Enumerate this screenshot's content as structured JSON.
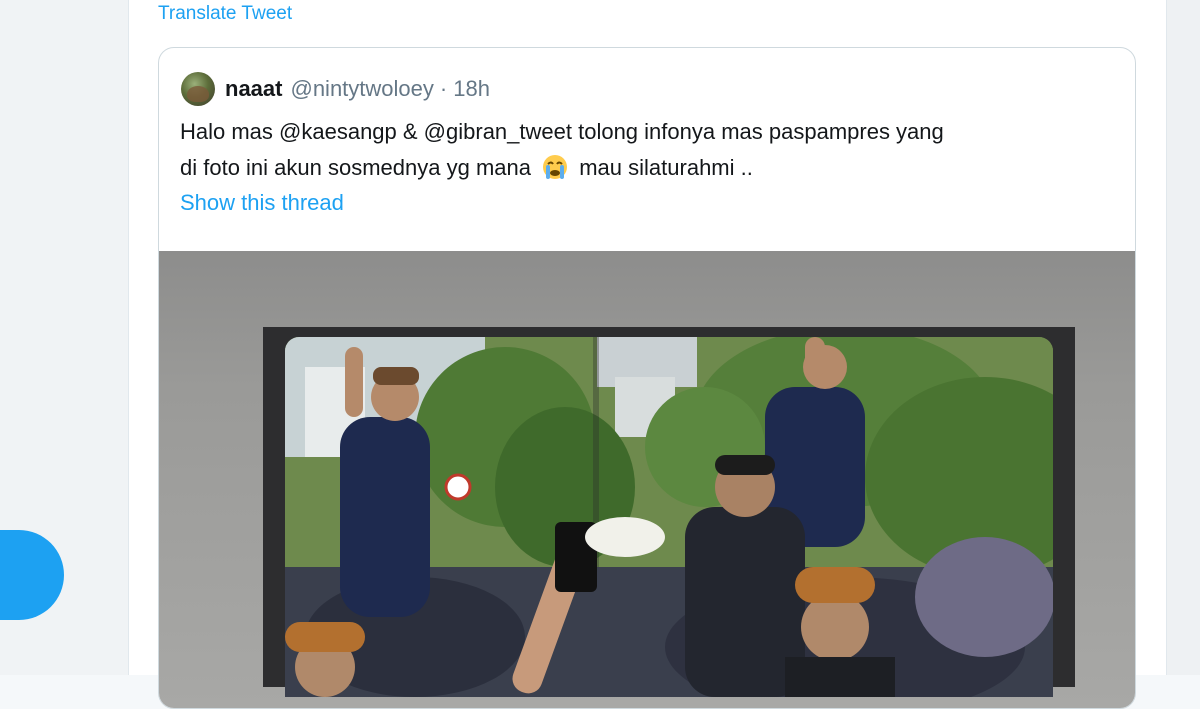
{
  "translate_label": "Translate Tweet",
  "quoted_tweet": {
    "name": "naaat",
    "handle": "@nintytwoloey",
    "separator": "·",
    "time": "18h",
    "text_line1": "Halo mas @kaesangp   & @gibran_tweet tolong infonya mas paspampres yang",
    "text_line2a": "di foto ini akun sosmednya yg mana",
    "emoji": "loudly-crying-face-emoji",
    "text_line2b": "mau silaturahmi ..",
    "show_thread": "Show this thread"
  },
  "icons": {
    "avatar": "profile-avatar",
    "fab": "compose-tweet-button"
  },
  "colors": {
    "link": "#1da1f2",
    "text": "#14171a",
    "muted": "#657786",
    "card_border": "#cfd9de"
  }
}
